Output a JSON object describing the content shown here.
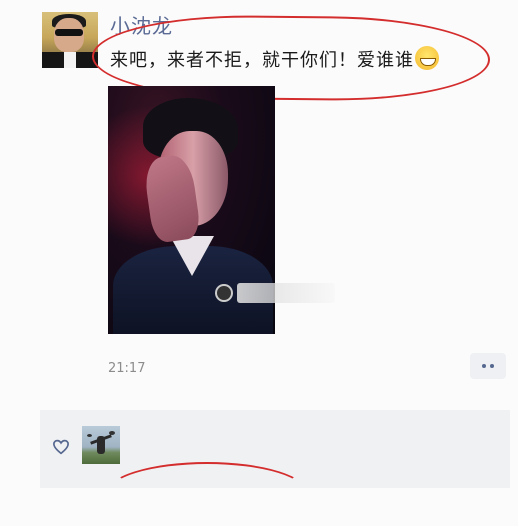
{
  "post": {
    "username": "小沈龙",
    "message": "来吧，来者不拒，就干你们！爱谁谁",
    "emoji_icon": "grinning-face-emoji",
    "timestamp": "21:17",
    "more_icon": "more-dots-icon"
  },
  "likes": {
    "like_icon": "heart-outline-icon"
  },
  "colors": {
    "username": "#5b6b95",
    "annotation": "#d42d2d",
    "likes_panel": "#f0f1f3"
  }
}
